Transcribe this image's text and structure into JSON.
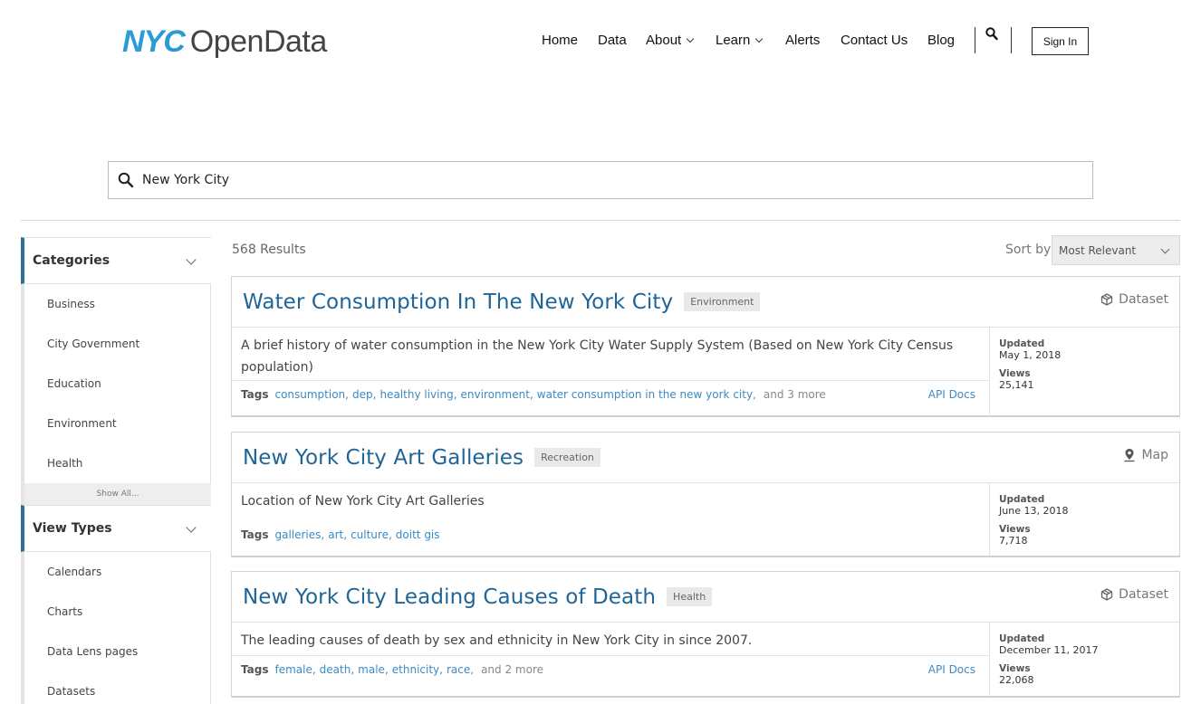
{
  "header": {
    "logo_nyc": "NYC",
    "logo_opendata": "OpenData",
    "nav": {
      "home": "Home",
      "data": "Data",
      "about": "About",
      "learn": "Learn",
      "alerts": "Alerts",
      "contact": "Contact Us",
      "blog": "Blog"
    },
    "sign_in": "Sign In"
  },
  "search": {
    "value": "New York City"
  },
  "sidebar": {
    "categories": {
      "title": "Categories",
      "items": [
        "Business",
        "City Government",
        "Education",
        "Environment",
        "Health"
      ],
      "show_all": "Show All..."
    },
    "view_types": {
      "title": "View Types",
      "items": [
        "Calendars",
        "Charts",
        "Data Lens pages",
        "Datasets"
      ]
    }
  },
  "results": {
    "count": "568 Results",
    "sort_label": "Sort by",
    "sort_value": "Most Relevant",
    "cards": [
      {
        "title": "Water Consumption In The New York City",
        "category": "Environment",
        "type": "Dataset",
        "description": "A brief history of water consumption in the New York City Water Supply System (Based on New York City Census population)",
        "tags_label": "Tags",
        "tags": [
          "consumption",
          "dep",
          "healthy living",
          "environment",
          "water consumption in the new york city"
        ],
        "more": "and 3 more",
        "api_docs": "API Docs",
        "updated_label": "Updated",
        "updated": "May 1, 2018",
        "views_label": "Views",
        "views": "25,141"
      },
      {
        "title": "New York City Art Galleries",
        "category": "Recreation",
        "type": "Map",
        "description": "Location of New York City Art Galleries",
        "tags_label": "Tags",
        "tags": [
          "galleries",
          "art",
          "culture",
          "doitt gis"
        ],
        "updated_label": "Updated",
        "updated": "June 13, 2018",
        "views_label": "Views",
        "views": "7,718"
      },
      {
        "title": "New York City Leading Causes of Death",
        "category": "Health",
        "type": "Dataset",
        "description": "The leading causes of death by sex and ethnicity in New York City in since 2007.",
        "tags_label": "Tags",
        "tags": [
          "female",
          "death",
          "male",
          "ethnicity",
          "race"
        ],
        "more": "and 2 more",
        "api_docs": "API Docs",
        "updated_label": "Updated",
        "updated": "December 11, 2017",
        "views_label": "Views",
        "views": "22,068"
      }
    ]
  }
}
